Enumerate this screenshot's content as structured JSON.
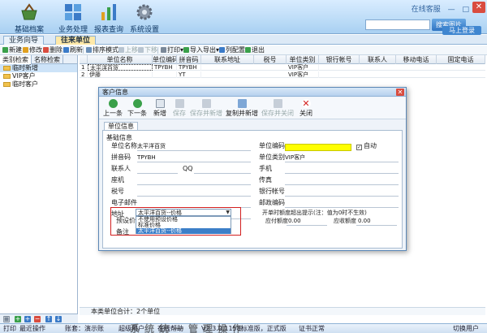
{
  "app": {
    "nav": [
      {
        "id": "basic",
        "label": "基础档案",
        "icon": "basket-icon"
      },
      {
        "id": "biz",
        "label": "业务处理",
        "icon": "grid-icon"
      },
      {
        "id": "report",
        "label": "报表查询",
        "icon": "bar-chart-icon"
      },
      {
        "id": "settings",
        "label": "系统设置",
        "icon": "gear-icon"
      }
    ],
    "top_links": [
      "在线客服",
      "—",
      "□"
    ],
    "close_glyph": "✕",
    "search_button": "搜索图片",
    "login_button": "马上登录"
  },
  "tabs": [
    {
      "label": "业务向导",
      "active": false
    },
    {
      "label": "往来单位",
      "active": true
    }
  ],
  "toolbar": [
    {
      "label": "新建",
      "disabled": false
    },
    {
      "label": "修改",
      "disabled": false
    },
    {
      "label": "删除",
      "disabled": false
    },
    {
      "label": "刷新",
      "disabled": false
    },
    {
      "label": "排序模式",
      "disabled": false
    },
    {
      "label": "上移",
      "disabled": true
    },
    {
      "label": "下移",
      "disabled": true
    },
    {
      "label": "打印",
      "disabled": false
    },
    {
      "label": "导入导出",
      "disabled": false
    },
    {
      "label": "列配置",
      "disabled": false
    },
    {
      "label": "退出",
      "disabled": false
    }
  ],
  "left": {
    "tabs": [
      "类别检索",
      "名称检索"
    ],
    "tree": [
      {
        "label": "临时新增",
        "selected": true
      },
      {
        "label": "VIP客户",
        "selected": false
      },
      {
        "label": "临时客户",
        "selected": false
      }
    ],
    "bottom_icons": [
      "□",
      "+",
      "+",
      "−",
      "↑",
      "↓"
    ]
  },
  "grid": {
    "columns": [
      "单位名称",
      "单位编码",
      "拼音码",
      "联系地址",
      "税号",
      "单位类别",
      "银行帐号",
      "联系人",
      "移动电话",
      "固定电话"
    ],
    "rows": [
      {
        "no": "1",
        "cells": [
          "太平洋百货",
          "TPYBH",
          "TPYBH",
          "",
          "",
          "VIP客户",
          "",
          "",
          "",
          ""
        ]
      },
      {
        "no": "2",
        "cells": [
          "伊藤",
          "",
          "YT",
          "",
          "",
          "VIP客户",
          "",
          "",
          "",
          ""
        ]
      }
    ],
    "footer": "本类单位合计：2个单位"
  },
  "status": {
    "items": [
      "打印",
      "最近操作",
      "账套：演示账",
      "超级用户",
      "在线帮助",
      "V2.3.0.1158标准版，正式版",
      "证书正常",
      "切换用户"
    ]
  },
  "dialog": {
    "title": "客户信息",
    "close_glyph": "✕",
    "toolbar": [
      {
        "label": "上一条",
        "disabled": false
      },
      {
        "label": "下一条",
        "disabled": false
      },
      {
        "label": "新增",
        "disabled": false
      },
      {
        "label": "保存",
        "disabled": true
      },
      {
        "label": "保存并新增",
        "disabled": true
      },
      {
        "label": "复制并新增",
        "disabled": false
      },
      {
        "label": "保存并关闭",
        "disabled": true
      },
      {
        "label": "关闭",
        "disabled": false
      }
    ],
    "tab": "单位信息",
    "section": "基础信息",
    "fields": {
      "name_label": "单位名称",
      "name_value": "太平洋百货",
      "code_label": "单位编码",
      "code_value": "",
      "auto_label": "自动",
      "pinyin_label": "拼音码",
      "pinyin_value": "TPYBH",
      "category_label": "单位类别",
      "category_value": "VIP客户",
      "contact_label": "联系人",
      "qq_label": "QQ",
      "mobile_label": "手机",
      "phone_label": "座机",
      "fax_label": "传真",
      "tax_label": "税号",
      "bank_label": "银行帐号",
      "email_label": "电子邮件",
      "zip_label": "邮政编码",
      "address_label": "地址",
      "credit_tip": "开单时额度超出提示(注：值为0时不生效)",
      "receivable_label": "应付额度",
      "receivable_value": "0.00",
      "collect_label": "应收额度",
      "collect_value": "0.00",
      "price_label": "预设价格",
      "price_value": "太平洋百货--价格",
      "remark_label": "备注"
    },
    "price_options": [
      {
        "label": "不使用预设价格",
        "highlighted": false
      },
      {
        "label": "标准价格",
        "highlighted": false
      },
      {
        "label": "太平洋百货--价格",
        "highlighted": true
      }
    ]
  },
  "watermark": "系统统一管理操作"
}
